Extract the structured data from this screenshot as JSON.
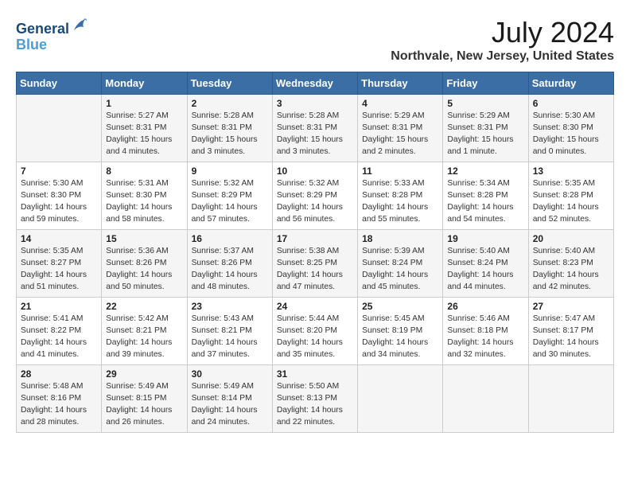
{
  "header": {
    "logo_line1": "General",
    "logo_line2": "Blue",
    "month": "July 2024",
    "location": "Northvale, New Jersey, United States"
  },
  "weekdays": [
    "Sunday",
    "Monday",
    "Tuesday",
    "Wednesday",
    "Thursday",
    "Friday",
    "Saturday"
  ],
  "weeks": [
    [
      {
        "day": "",
        "info": ""
      },
      {
        "day": "1",
        "info": "Sunrise: 5:27 AM\nSunset: 8:31 PM\nDaylight: 15 hours\nand 4 minutes."
      },
      {
        "day": "2",
        "info": "Sunrise: 5:28 AM\nSunset: 8:31 PM\nDaylight: 15 hours\nand 3 minutes."
      },
      {
        "day": "3",
        "info": "Sunrise: 5:28 AM\nSunset: 8:31 PM\nDaylight: 15 hours\nand 3 minutes."
      },
      {
        "day": "4",
        "info": "Sunrise: 5:29 AM\nSunset: 8:31 PM\nDaylight: 15 hours\nand 2 minutes."
      },
      {
        "day": "5",
        "info": "Sunrise: 5:29 AM\nSunset: 8:31 PM\nDaylight: 15 hours\nand 1 minute."
      },
      {
        "day": "6",
        "info": "Sunrise: 5:30 AM\nSunset: 8:30 PM\nDaylight: 15 hours\nand 0 minutes."
      }
    ],
    [
      {
        "day": "7",
        "info": "Sunrise: 5:30 AM\nSunset: 8:30 PM\nDaylight: 14 hours\nand 59 minutes."
      },
      {
        "day": "8",
        "info": "Sunrise: 5:31 AM\nSunset: 8:30 PM\nDaylight: 14 hours\nand 58 minutes."
      },
      {
        "day": "9",
        "info": "Sunrise: 5:32 AM\nSunset: 8:29 PM\nDaylight: 14 hours\nand 57 minutes."
      },
      {
        "day": "10",
        "info": "Sunrise: 5:32 AM\nSunset: 8:29 PM\nDaylight: 14 hours\nand 56 minutes."
      },
      {
        "day": "11",
        "info": "Sunrise: 5:33 AM\nSunset: 8:28 PM\nDaylight: 14 hours\nand 55 minutes."
      },
      {
        "day": "12",
        "info": "Sunrise: 5:34 AM\nSunset: 8:28 PM\nDaylight: 14 hours\nand 54 minutes."
      },
      {
        "day": "13",
        "info": "Sunrise: 5:35 AM\nSunset: 8:28 PM\nDaylight: 14 hours\nand 52 minutes."
      }
    ],
    [
      {
        "day": "14",
        "info": "Sunrise: 5:35 AM\nSunset: 8:27 PM\nDaylight: 14 hours\nand 51 minutes."
      },
      {
        "day": "15",
        "info": "Sunrise: 5:36 AM\nSunset: 8:26 PM\nDaylight: 14 hours\nand 50 minutes."
      },
      {
        "day": "16",
        "info": "Sunrise: 5:37 AM\nSunset: 8:26 PM\nDaylight: 14 hours\nand 48 minutes."
      },
      {
        "day": "17",
        "info": "Sunrise: 5:38 AM\nSunset: 8:25 PM\nDaylight: 14 hours\nand 47 minutes."
      },
      {
        "day": "18",
        "info": "Sunrise: 5:39 AM\nSunset: 8:24 PM\nDaylight: 14 hours\nand 45 minutes."
      },
      {
        "day": "19",
        "info": "Sunrise: 5:40 AM\nSunset: 8:24 PM\nDaylight: 14 hours\nand 44 minutes."
      },
      {
        "day": "20",
        "info": "Sunrise: 5:40 AM\nSunset: 8:23 PM\nDaylight: 14 hours\nand 42 minutes."
      }
    ],
    [
      {
        "day": "21",
        "info": "Sunrise: 5:41 AM\nSunset: 8:22 PM\nDaylight: 14 hours\nand 41 minutes."
      },
      {
        "day": "22",
        "info": "Sunrise: 5:42 AM\nSunset: 8:21 PM\nDaylight: 14 hours\nand 39 minutes."
      },
      {
        "day": "23",
        "info": "Sunrise: 5:43 AM\nSunset: 8:21 PM\nDaylight: 14 hours\nand 37 minutes."
      },
      {
        "day": "24",
        "info": "Sunrise: 5:44 AM\nSunset: 8:20 PM\nDaylight: 14 hours\nand 35 minutes."
      },
      {
        "day": "25",
        "info": "Sunrise: 5:45 AM\nSunset: 8:19 PM\nDaylight: 14 hours\nand 34 minutes."
      },
      {
        "day": "26",
        "info": "Sunrise: 5:46 AM\nSunset: 8:18 PM\nDaylight: 14 hours\nand 32 minutes."
      },
      {
        "day": "27",
        "info": "Sunrise: 5:47 AM\nSunset: 8:17 PM\nDaylight: 14 hours\nand 30 minutes."
      }
    ],
    [
      {
        "day": "28",
        "info": "Sunrise: 5:48 AM\nSunset: 8:16 PM\nDaylight: 14 hours\nand 28 minutes."
      },
      {
        "day": "29",
        "info": "Sunrise: 5:49 AM\nSunset: 8:15 PM\nDaylight: 14 hours\nand 26 minutes."
      },
      {
        "day": "30",
        "info": "Sunrise: 5:49 AM\nSunset: 8:14 PM\nDaylight: 14 hours\nand 24 minutes."
      },
      {
        "day": "31",
        "info": "Sunrise: 5:50 AM\nSunset: 8:13 PM\nDaylight: 14 hours\nand 22 minutes."
      },
      {
        "day": "",
        "info": ""
      },
      {
        "day": "",
        "info": ""
      },
      {
        "day": "",
        "info": ""
      }
    ]
  ]
}
